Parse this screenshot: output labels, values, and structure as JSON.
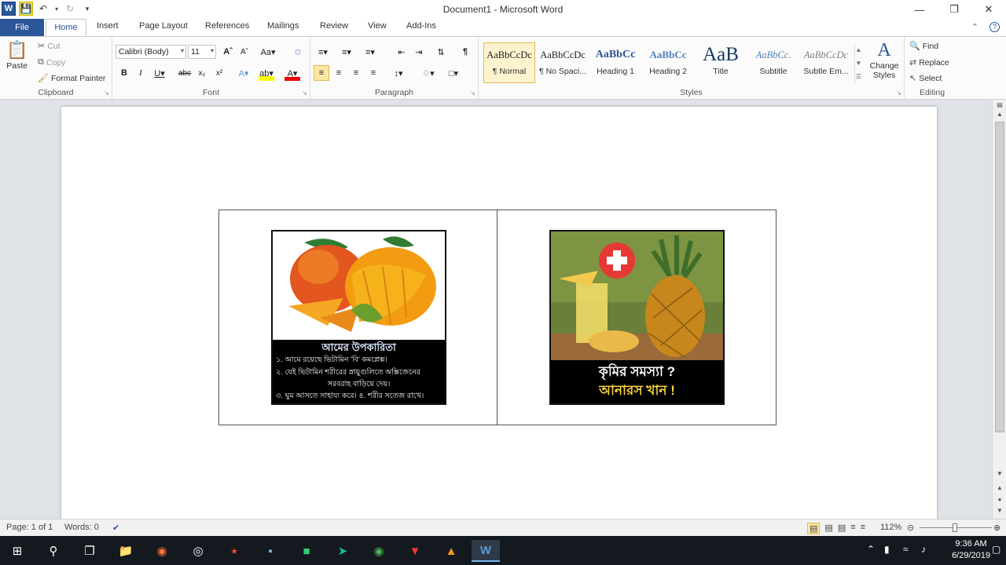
{
  "window": {
    "title": "Document1 - Microsoft Word",
    "app_icon": "W",
    "controls": [
      "minimize-icon",
      "restore-icon",
      "close-icon"
    ]
  },
  "ribbon_tabs": [
    "File",
    "Home",
    "Insert",
    "Page Layout",
    "References",
    "Mailings",
    "Review",
    "View",
    "Add-Ins"
  ],
  "clipboard": {
    "paste": "Paste",
    "cut": "Cut",
    "copy": "Copy",
    "format_painter": "Format Painter",
    "label": "Clipboard"
  },
  "font": {
    "name": "Calibri (Body)",
    "size": "11",
    "label": "Font"
  },
  "paragraph": {
    "label": "Paragraph"
  },
  "styles": {
    "items": [
      {
        "sample": "AaBbCcDc",
        "name": "¶ Normal"
      },
      {
        "sample": "AaBbCcDc",
        "name": "¶ No Spaci..."
      },
      {
        "sample": "AaBbCc",
        "name": "Heading 1"
      },
      {
        "sample": "AaBbCc",
        "name": "Heading 2"
      },
      {
        "sample": "AaB",
        "name": "Title"
      },
      {
        "sample": "AaBbCc.",
        "name": "Subtitle"
      },
      {
        "sample": "AaBbCcDc",
        "name": "Subtle Em..."
      }
    ],
    "change_styles": "Change Styles",
    "label": "Styles"
  },
  "editing": {
    "find": "Find",
    "replace": "Replace",
    "select": "Select",
    "label": "Editing"
  },
  "document": {
    "image1": {
      "title": "আমের উপকারিতা",
      "lines": [
        "১. আমে রয়েছে ভিটামিন 'বি' কমপ্লেক্স।",
        "২. যেই ভিটামিন শরীরের স্নায়ুগুলিতে অক্সিজেনের",
        "সরবরাহ বাড়িয়ে দেয়।",
        "৩. ঘুম আসতে সাহায্য করে। ৪. শরীর সতেজ রাখে।"
      ]
    },
    "image2": {
      "line1": "কৃমির সমস্যা ?",
      "line2": "আনারস খান !"
    }
  },
  "status": {
    "page": "Page: 1 of 1",
    "words": "Words: 0",
    "zoom": "112%"
  },
  "taskbar": {
    "time": "9:36 AM",
    "date": "6/29/2019"
  }
}
